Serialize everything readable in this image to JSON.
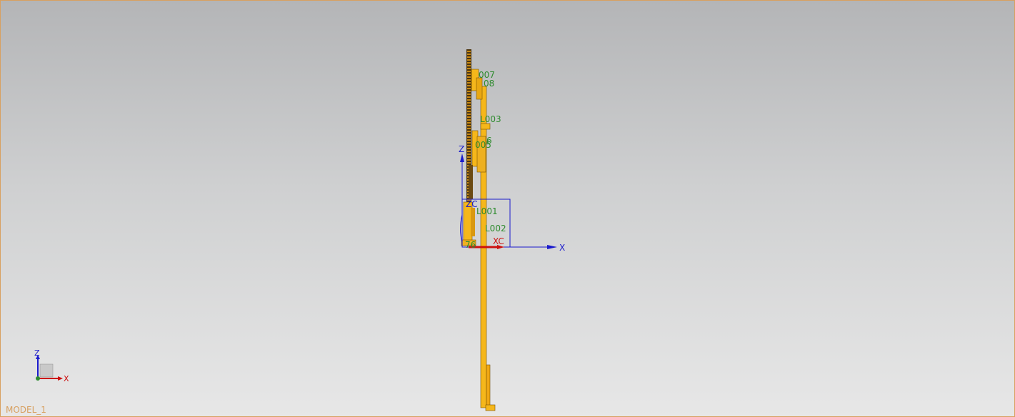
{
  "viewport": {
    "model_name": "MODEL_1",
    "colors": {
      "border": "#d8a060",
      "part_fill": "#f5b71b",
      "part_edge": "#7a5200",
      "gear_dark": "#4a3410",
      "label_green": "#2e8b2e",
      "axis_blue": "#1a1acc",
      "axis_red": "#cc1111"
    }
  },
  "part_labels": [
    {
      "text": "007"
    },
    {
      "text": "08"
    },
    {
      "text": "L003"
    },
    {
      "text": "6"
    },
    {
      "text": "005"
    },
    {
      "text": "L001"
    },
    {
      "text": "L002"
    },
    {
      "text": "76"
    }
  ],
  "wcs": {
    "z_label": "Z",
    "x_label": "X",
    "zc_label": "ZC",
    "xc_label": "XC"
  },
  "triad": {
    "z_label": "Z",
    "x_label": "X"
  }
}
